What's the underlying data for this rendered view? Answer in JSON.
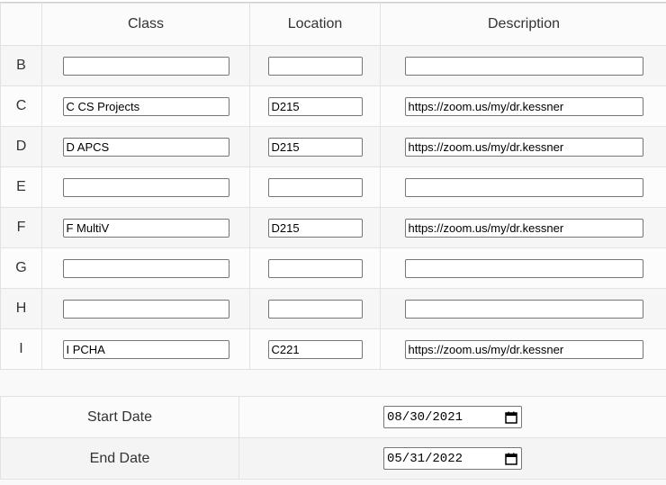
{
  "headers": {
    "period": "",
    "class": "Class",
    "location": "Location",
    "description": "Description"
  },
  "rows": [
    {
      "period": "B",
      "class": "",
      "location": "",
      "description": ""
    },
    {
      "period": "C",
      "class": "C CS Projects",
      "location": "D215",
      "description": "https://zoom.us/my/dr.kessner"
    },
    {
      "period": "D",
      "class": "D APCS",
      "location": "D215",
      "description": "https://zoom.us/my/dr.kessner"
    },
    {
      "period": "E",
      "class": "",
      "location": "",
      "description": ""
    },
    {
      "period": "F",
      "class": "F MultiV",
      "location": "D215",
      "description": "https://zoom.us/my/dr.kessner"
    },
    {
      "period": "G",
      "class": "",
      "location": "",
      "description": ""
    },
    {
      "period": "H",
      "class": "",
      "location": "",
      "description": ""
    },
    {
      "period": "I",
      "class": "I PCHA",
      "location": "C221",
      "description": "https://zoom.us/my/dr.kessner"
    }
  ],
  "dates": {
    "start_label": "Start Date",
    "start_value": "08/30/2021",
    "end_label": "End Date",
    "end_value": "05/31/2022"
  },
  "icons": {
    "date_picker": "calendar-icon"
  }
}
